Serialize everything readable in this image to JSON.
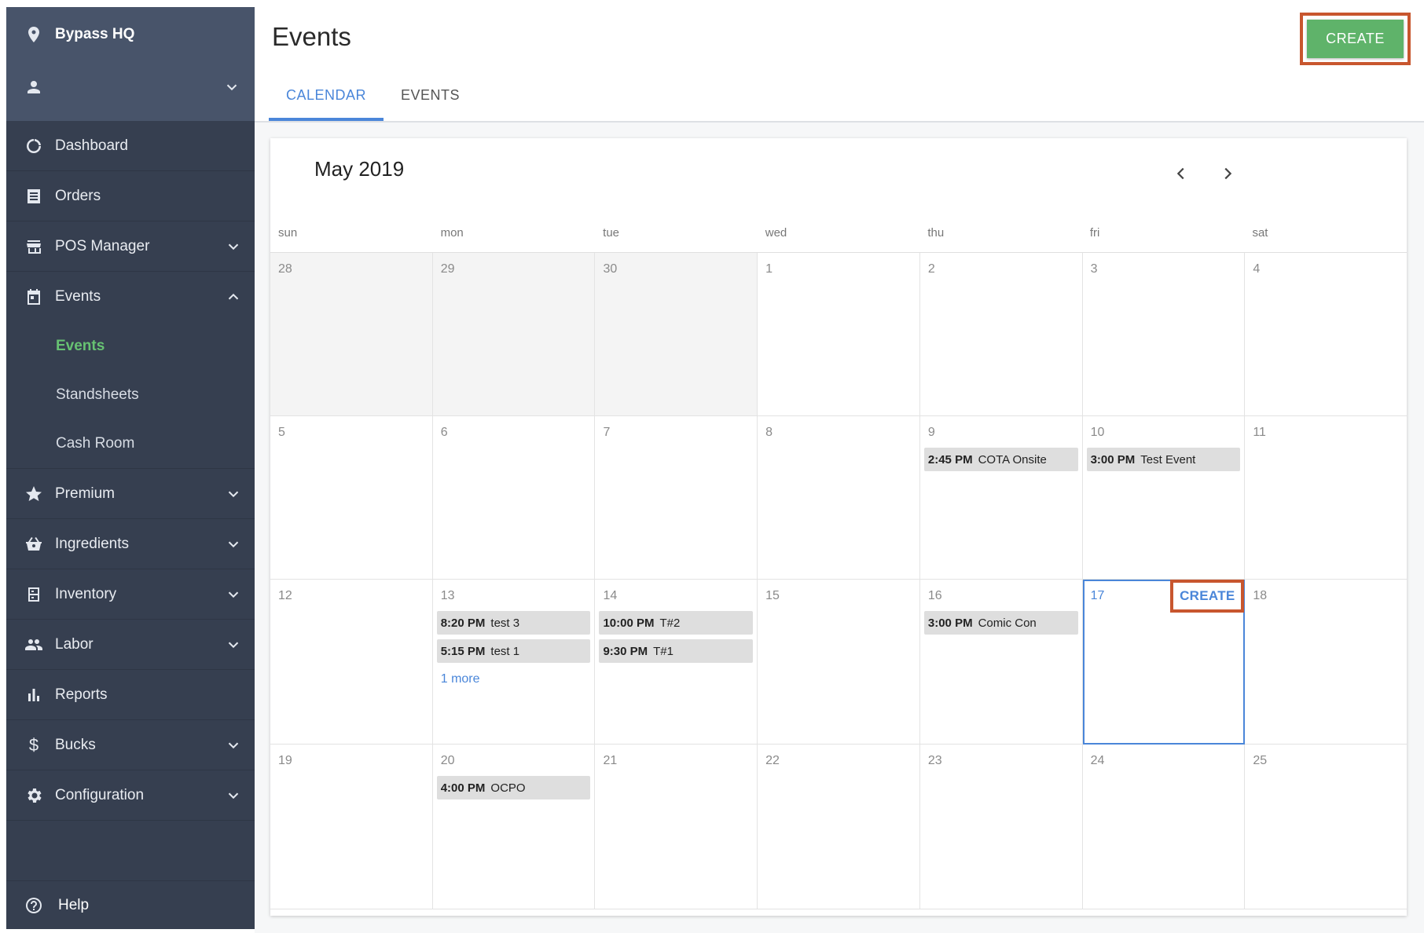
{
  "sidebar": {
    "location": "Bypass HQ",
    "items": [
      {
        "label": "Dashboard",
        "icon": "dashboard-icon"
      },
      {
        "label": "Orders",
        "icon": "orders-icon"
      },
      {
        "label": "POS Manager",
        "icon": "store-icon"
      },
      {
        "label": "Events",
        "icon": "calendar-icon"
      },
      {
        "label": "Premium",
        "icon": "star-icon"
      },
      {
        "label": "Ingredients",
        "icon": "basket-icon"
      },
      {
        "label": "Inventory",
        "icon": "inventory-icon"
      },
      {
        "label": "Labor",
        "icon": "people-icon"
      },
      {
        "label": "Reports",
        "icon": "bar-chart-icon"
      },
      {
        "label": "Bucks",
        "icon": "dollar-icon"
      },
      {
        "label": "Configuration",
        "icon": "gear-icon"
      }
    ],
    "events_sub": [
      "Events",
      "Standsheets",
      "Cash Room"
    ],
    "help": "Help",
    "active_color": "#67c272"
  },
  "header": {
    "title": "Events",
    "create_label": "CREATE",
    "tabs": [
      "CALENDAR",
      "EVENTS"
    ]
  },
  "calendar": {
    "month": "May 2019",
    "dow": [
      "sun",
      "mon",
      "tue",
      "wed",
      "thu",
      "fri",
      "sat"
    ],
    "weeks": [
      {
        "days": [
          "28",
          "29",
          "30",
          "1",
          "2",
          "3",
          "4"
        ]
      },
      {
        "days": [
          "5",
          "6",
          "7",
          "8",
          "9",
          "10",
          "11"
        ]
      },
      {
        "days": [
          "12",
          "13",
          "14",
          "15",
          "16",
          "17",
          "18"
        ]
      },
      {
        "days": [
          "19",
          "20",
          "21",
          "22",
          "23",
          "24",
          "25"
        ]
      }
    ],
    "events": {
      "may9": [
        {
          "time": "2:45 PM",
          "name": "COTA Onsite"
        }
      ],
      "may10": [
        {
          "time": "3:00 PM",
          "name": "Test Event"
        }
      ],
      "may13": [
        {
          "time": "8:20 PM",
          "name": "test 3"
        },
        {
          "time": "5:15 PM",
          "name": "test 1"
        }
      ],
      "may13_more": "1 more",
      "may14": [
        {
          "time": "10:00 PM",
          "name": "T#2"
        },
        {
          "time": "9:30 PM",
          "name": "T#1"
        }
      ],
      "may16": [
        {
          "time": "3:00 PM",
          "name": "Comic Con"
        }
      ],
      "may20": [
        {
          "time": "4:00 PM",
          "name": "OCPO"
        }
      ]
    },
    "day_create_label": "CREATE"
  }
}
